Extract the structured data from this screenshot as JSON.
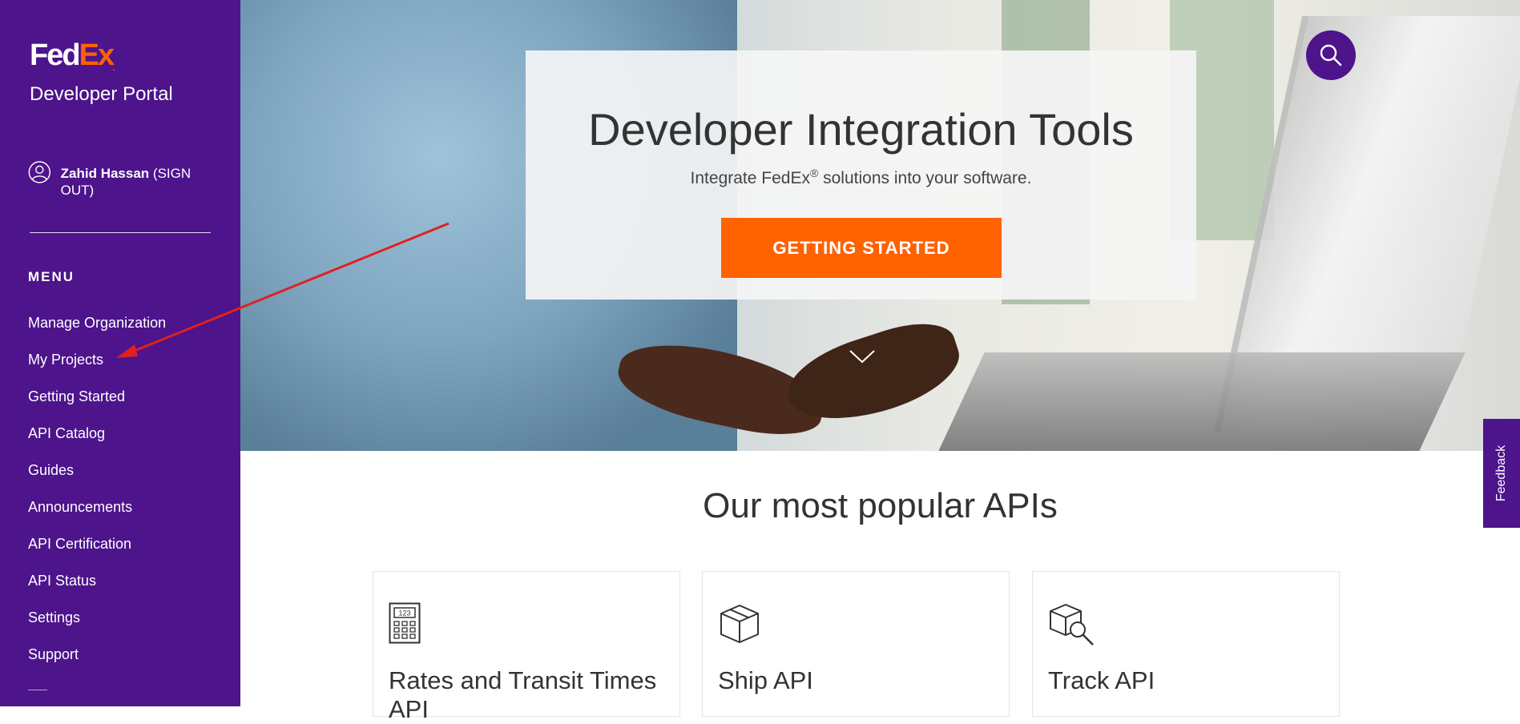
{
  "brand": {
    "logo_fed": "Fed",
    "logo_ex": "Ex",
    "portal_title": "Developer Portal"
  },
  "user": {
    "name": "Zahid Hassan",
    "sign_out": "(SIGN OUT)"
  },
  "menu": {
    "heading": "MENU",
    "items": [
      {
        "label": "Manage Organization"
      },
      {
        "label": "My Projects"
      },
      {
        "label": "Getting Started"
      },
      {
        "label": "API Catalog"
      },
      {
        "label": "Guides"
      },
      {
        "label": "Announcements"
      },
      {
        "label": "API Certification"
      },
      {
        "label": "API Status"
      },
      {
        "label": "Settings"
      },
      {
        "label": "Support"
      }
    ]
  },
  "hero": {
    "title": "Developer Integration Tools",
    "subtitle_prefix": "Integrate FedEx",
    "subtitle_reg": "®",
    "subtitle_suffix": " solutions into your software.",
    "cta_label": "GETTING STARTED"
  },
  "feedback": {
    "label": "Feedback"
  },
  "popular": {
    "title": "Our most popular APIs",
    "cards": [
      {
        "name": "Rates and Transit Times API",
        "icon": "calculator-icon",
        "icon_text": "123"
      },
      {
        "name": "Ship API",
        "icon": "box-icon"
      },
      {
        "name": "Track API",
        "icon": "box-search-icon"
      }
    ]
  },
  "colors": {
    "purple": "#4d148c",
    "orange": "#ff6200",
    "annotation": "#e02020"
  }
}
